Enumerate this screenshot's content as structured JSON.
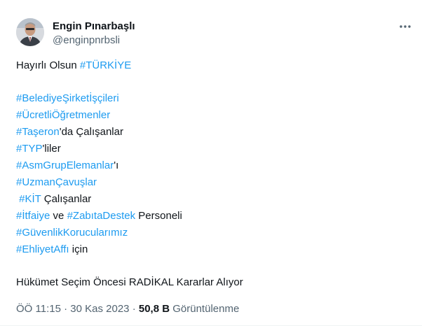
{
  "author": {
    "name": "Engin Pınarbaşlı",
    "handle": "@enginpnrbsli"
  },
  "tweet": {
    "intro_text": "Hayırlı Olsun ",
    "intro_tag": "#TÜRKİYE",
    "lines": [
      {
        "tag": "#BelediyeŞirketİşçileri",
        "after": ""
      },
      {
        "tag": "#ÜcretliÖğretmenler",
        "after": ""
      },
      {
        "tag": "#Taşeron",
        "after": "'da Çalışanlar"
      },
      {
        "tag": "#TYP",
        "after": "'liler"
      },
      {
        "tag": "#AsmGrupElemanlar",
        "after": "'ı"
      },
      {
        "tag": "#UzmanÇavuşlar",
        "after": ""
      },
      {
        "before": " ",
        "tag": "#KİT",
        "after": " Çalışanlar"
      },
      {
        "tag": "#İtfaiye",
        "mid": " ve ",
        "tag2": "#ZabıtaDestek",
        "after": " Personeli"
      },
      {
        "tag": "#GüvenlikKorucularımız",
        "after": ""
      },
      {
        "tag": "#EhliyetAffı",
        "after": " için"
      }
    ],
    "closing": "Hükümet Seçim Öncesi RADİKAL Kararlar Alıyor"
  },
  "meta": {
    "time": "ÖÖ 11:15",
    "sep1": " · ",
    "date": "30 Kas 2023",
    "sep2": " · ",
    "views_count": "50,8 B",
    "views_label": " Görüntülenme"
  },
  "icons": {
    "more": "more-horizontal-icon",
    "avatar": "profile-photo"
  },
  "colors": {
    "hashtag": "#1d9bf0",
    "secondary": "#536471",
    "text": "#0f1419"
  }
}
